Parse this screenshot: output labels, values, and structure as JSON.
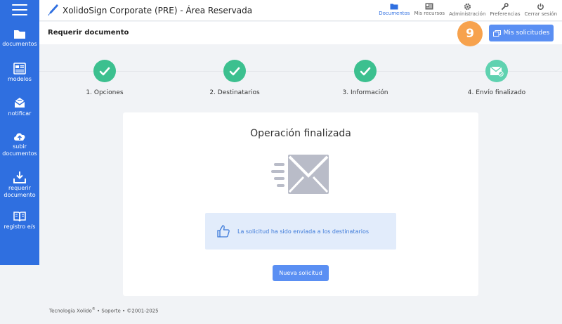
{
  "sidebar": {
    "items": [
      {
        "label": "documentos",
        "icon": "folder-icon"
      },
      {
        "label": "modelos",
        "icon": "template-icon"
      },
      {
        "label": "notificar",
        "icon": "notify-icon"
      },
      {
        "label": "subir documentos",
        "icon": "upload-cloud-icon"
      },
      {
        "label": "requerir documento",
        "icon": "download-tray-icon"
      },
      {
        "label": "registro e/s",
        "icon": "book-icon"
      }
    ]
  },
  "topbar": {
    "title": "XolidoSign Corporate (PRE) - Área Reservada",
    "nav": [
      {
        "label": "Documentos",
        "icon": "folder-icon",
        "active": true
      },
      {
        "label": "Mis recursos",
        "icon": "id-card-icon",
        "active": false
      },
      {
        "label": "Administración",
        "icon": "gear-icon",
        "active": false
      },
      {
        "label": "Preferencias",
        "icon": "wrench-icon",
        "active": false
      },
      {
        "label": "Cerrar sesión",
        "icon": "power-icon",
        "active": false
      }
    ]
  },
  "subheader": {
    "title": "Requerir documento",
    "badge": "9",
    "my_requests_label": "Mis solicitudes"
  },
  "steps": [
    {
      "label": "1. Opciones",
      "status": "done"
    },
    {
      "label": "2. Destinatarios",
      "status": "done"
    },
    {
      "label": "3. Información",
      "status": "done"
    },
    {
      "label": "4. Envío finalizado",
      "status": "final"
    }
  ],
  "card": {
    "title": "Operación finalizada",
    "info_text": "La solicitud ha sido enviada a los destinatarios",
    "new_request_label": "Nueva solicitud"
  },
  "footer": {
    "brand": "Tecnología Xolido",
    "reg": "®",
    "support": "Soporte",
    "copyright": "©2001-2025",
    "separator": "•"
  },
  "colors": {
    "sidebar": "#2f6fe0",
    "accent_button": "#5a8ff3",
    "step_done": "#3cc08f",
    "badge": "#f7a24d",
    "info_bg": "#e2ecfb"
  }
}
